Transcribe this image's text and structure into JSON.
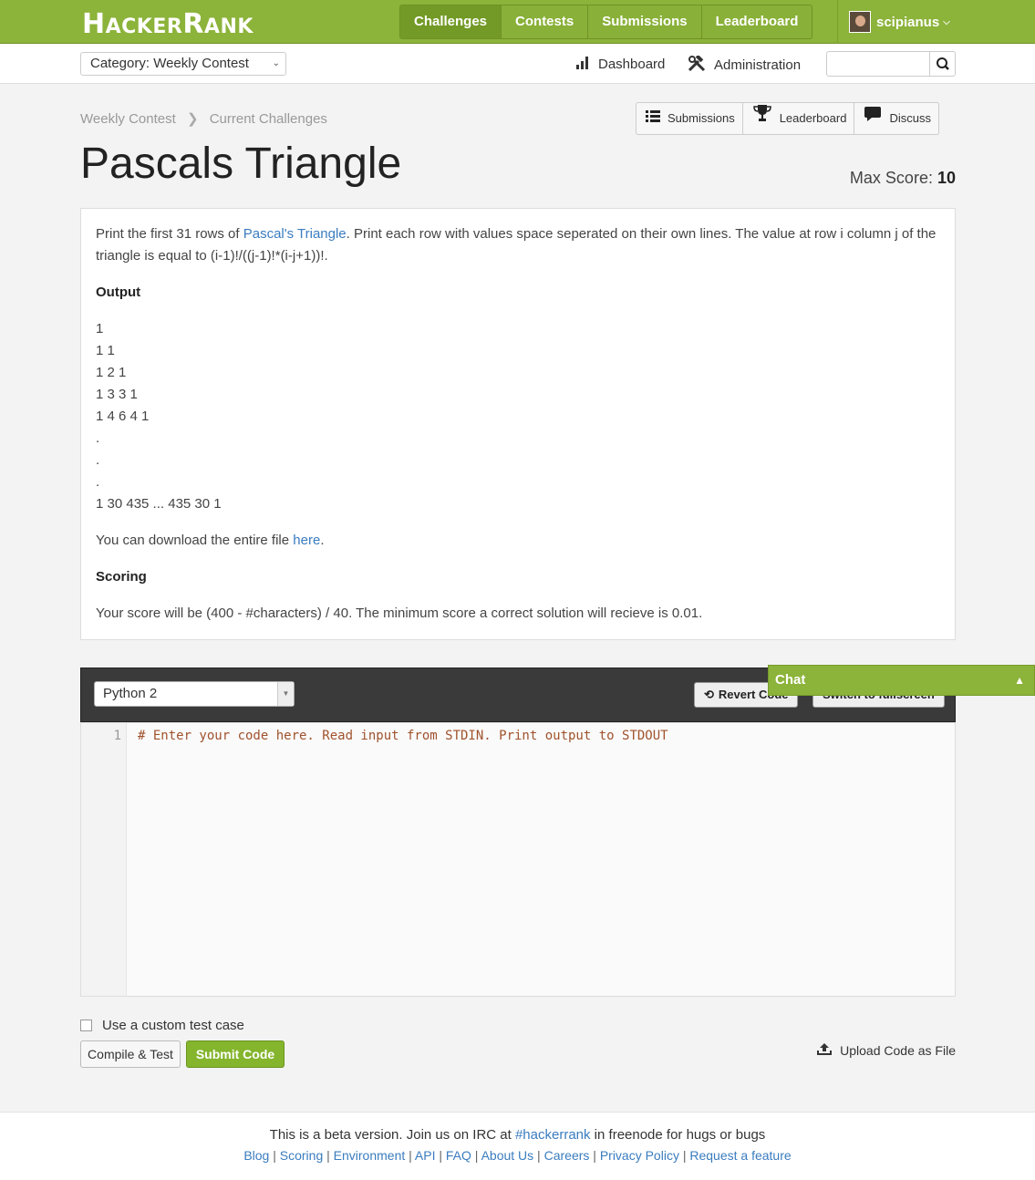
{
  "header": {
    "logo_text": "HACKERRANK",
    "logo_first": "H",
    "logo_rest": "ACKER",
    "logo_second": "R",
    "logo_end": "ANK",
    "nav": [
      {
        "label": "Challenges",
        "active": true
      },
      {
        "label": "Contests"
      },
      {
        "label": "Submissions"
      },
      {
        "label": "Leaderboard"
      }
    ],
    "username": "scipianus"
  },
  "subbar": {
    "category": "Category: Weekly Contest",
    "dashboard": "Dashboard",
    "administration": "Administration",
    "search_value": ""
  },
  "breadcrumb": [
    "Weekly Contest",
    "Current Challenges"
  ],
  "actions": {
    "submissions": "Submissions",
    "leaderboard": "Leaderboard",
    "discuss": "Discuss"
  },
  "challenge": {
    "title": "Pascals Triangle",
    "max_score_label": "Max Score:",
    "max_score": "10",
    "intro_pre": "Print the first 31 rows of ",
    "intro_link": "Pascal's Triangle",
    "intro_post": ". Print each row with values space seperated on their own lines. The value at row i column j of the triangle is equal to (i-1)!/((j-1)!*(i-j+1))!.",
    "output_heading": "Output",
    "output_lines": [
      "1",
      "1 1",
      "1 2 1",
      "1 3 3 1",
      "1 4 6 4 1",
      ".",
      ".",
      ".",
      "1 30 435 ... 435 30 1"
    ],
    "download_pre": "You can download the entire file ",
    "download_link": "here",
    "download_post": ".",
    "scoring_heading": "Scoring",
    "scoring_text": "Your score will be (400 - #characters) / 40. The minimum score a correct solution will recieve is 0.01."
  },
  "editor": {
    "language": "Python 2",
    "revert_label": "Revert Code",
    "fullscreen_label": "Switch to fullscreen",
    "line_number": "1",
    "code": "# Enter your code here. Read input from STDIN. Print output to STDOUT"
  },
  "chat": {
    "label": "Chat"
  },
  "submit_area": {
    "custom_test_label": "Use a custom test case",
    "compile_label": "Compile & Test",
    "submit_label": "Submit Code",
    "upload_label": "Upload Code as File"
  },
  "footer": {
    "beta_pre": "This is a beta version. Join us on IRC at ",
    "beta_link": "#hackerrank",
    "beta_post": " in freenode for hugs or bugs",
    "links": [
      "Blog",
      "Scoring",
      "Environment",
      "API",
      "FAQ",
      "About Us",
      "Careers",
      "Privacy Policy",
      "Request a feature"
    ]
  },
  "colors": {
    "brand_green": "#8cb33a",
    "link_blue": "#3a7cbf",
    "code_brown": "#a0522d"
  }
}
